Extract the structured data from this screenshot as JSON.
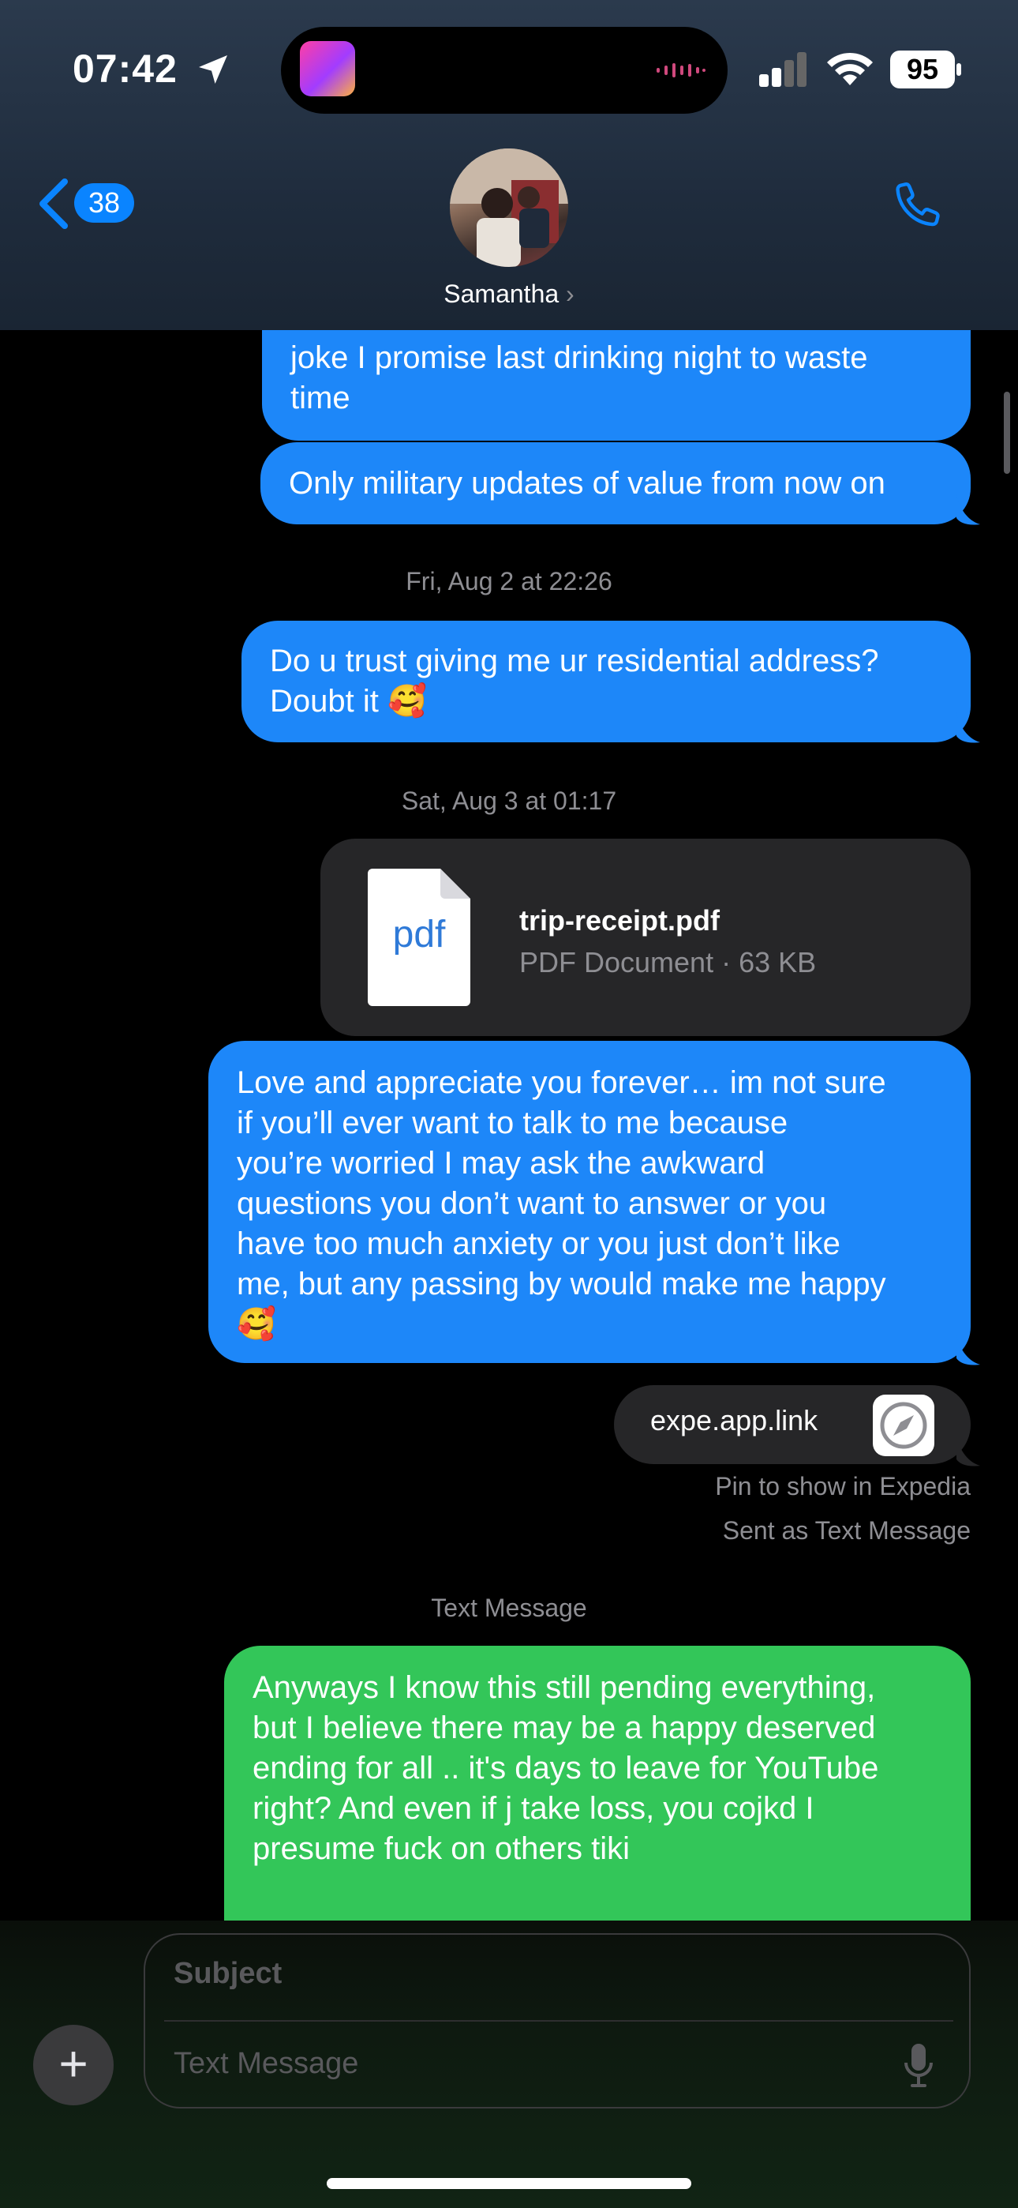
{
  "status_bar": {
    "time": "07:42",
    "battery": "95"
  },
  "header": {
    "back_count": "38",
    "contact_name": "Samantha",
    "contact_chevron": "›"
  },
  "messages": {
    "partial_bubble": [
      "joke I promise last drinking night to waste",
      "time"
    ],
    "msg1": "Only military updates of value from now on",
    "ts1": "Fri, Aug 2 at 22:26",
    "msg2": [
      "Do u trust giving me ur residential address?",
      "Doubt it 🥰"
    ],
    "ts2": "Sat, Aug 3 at 01:17",
    "attachment": {
      "icon_label": "pdf",
      "name": "trip-receipt.pdf",
      "meta": "PDF Document · 63 KB"
    },
    "msg3": [
      "Love and appreciate you forever… im not sure",
      "if you’ll ever want to talk to me because",
      "you’re worried I may ask the awkward",
      "questions you don’t want to answer or you",
      "have too much anxiety or you just don’t like",
      "me, but any passing by would make me happy",
      "🥰"
    ],
    "link": {
      "text": "expe.app.link",
      "pin_note": "Pin to show in Expedia",
      "sent_note": "Sent as Text Message"
    },
    "ts3": "Text Message",
    "msg4": [
      "Anyways I know this still pending everything,",
      "but I believe there may be a happy deserved",
      "ending for all .. it's days to leave for YouTube",
      "right? And even if j take loss, you cojkd I",
      "presume fuck on others tiki"
    ]
  },
  "composer": {
    "subject_placeholder": "Subject",
    "message_placeholder": "Text Message",
    "plus": "+"
  },
  "colors": {
    "imessage_blue": "#1d87f9",
    "sms_green": "#33c659",
    "accent": "#0a84ff"
  },
  "icons": [
    "location-arrow-icon",
    "signal-icon",
    "wifi-icon",
    "battery-icon",
    "back-chevron-icon",
    "phone-icon",
    "pdf-file-icon",
    "safari-compass-icon",
    "plus-icon",
    "microphone-icon"
  ]
}
